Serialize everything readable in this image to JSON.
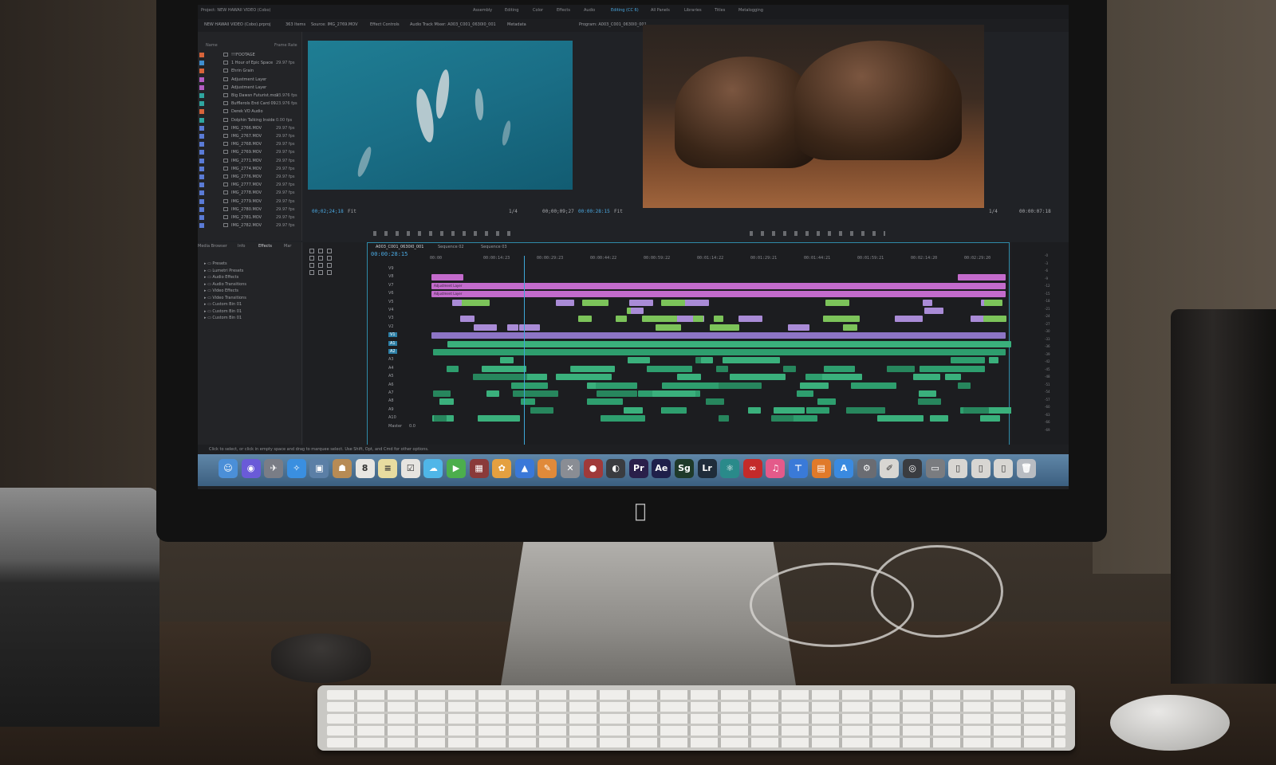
{
  "screen": {
    "project_title": "Project: NEW HAWAII VIDEO (Cobo)",
    "project_file": "NEW HAWAII VIDEO (Cobo).prproj",
    "items_count": "363 Items",
    "workspaces": [
      "Assembly",
      "Editing",
      "Color",
      "Effects",
      "Audio",
      "Editing (CC 6)",
      "All Panels",
      "Libraries",
      "Titles",
      "Metalogging"
    ],
    "active_workspace": "Editing (CC 6)",
    "source_tab": "Source: IMG_2769.MOV",
    "effect_controls_tab": "Effect Controls",
    "audio_mixer_tab": "Audio Track Mixer: A003_C001_0630I0_001",
    "metadata_tab": "Metadata",
    "program_tab": "Program: A003_C001_0630I0_001",
    "project_columns": {
      "name": "Name",
      "frame_rate": "Frame Rate"
    },
    "project_items": [
      {
        "name": "!!!FOOTAGE",
        "rate": "",
        "color": "#d8643a"
      },
      {
        "name": "1 Hour of Epic Space",
        "rate": "29.97 fps",
        "color": "#3f8fd0"
      },
      {
        "name": "Ehrin Grain",
        "rate": "",
        "color": "#d8643a"
      },
      {
        "name": "Adjustment Layer",
        "rate": "",
        "color": "#b45cc4"
      },
      {
        "name": "Adjustment Layer",
        "rate": "",
        "color": "#b45cc4"
      },
      {
        "name": "Big Dawsn Futurist.mov",
        "rate": "23.976 fps",
        "color": "#2fa6a0"
      },
      {
        "name": "Bufflerols End Card 09",
        "rate": "23.976 fps",
        "color": "#2fa6a0"
      },
      {
        "name": "Derek VO Audio",
        "rate": "",
        "color": "#d8643a"
      },
      {
        "name": "Dolphin Talking Inside",
        "rate": "0.00 fps",
        "color": "#2fa6a0"
      },
      {
        "name": "IMG_2766.MOV",
        "rate": "29.97 fps",
        "color": "#5a7bd6"
      },
      {
        "name": "IMG_2767.MOV",
        "rate": "29.97 fps",
        "color": "#5a7bd6"
      },
      {
        "name": "IMG_2768.MOV",
        "rate": "29.97 fps",
        "color": "#5a7bd6"
      },
      {
        "name": "IMG_2769.MOV",
        "rate": "29.97 fps",
        "color": "#5a7bd6"
      },
      {
        "name": "IMG_2771.MOV",
        "rate": "29.97 fps",
        "color": "#5a7bd6"
      },
      {
        "name": "IMG_2774.MOV",
        "rate": "29.97 fps",
        "color": "#5a7bd6"
      },
      {
        "name": "IMG_2776.MOV",
        "rate": "29.97 fps",
        "color": "#5a7bd6"
      },
      {
        "name": "IMG_2777.MOV",
        "rate": "29.97 fps",
        "color": "#5a7bd6"
      },
      {
        "name": "IMG_2778.MOV",
        "rate": "29.97 fps",
        "color": "#5a7bd6"
      },
      {
        "name": "IMG_2779.MOV",
        "rate": "29.97 fps",
        "color": "#5a7bd6"
      },
      {
        "name": "IMG_2780.MOV",
        "rate": "29.97 fps",
        "color": "#5a7bd6"
      },
      {
        "name": "IMG_2781.MOV",
        "rate": "29.97 fps",
        "color": "#5a7bd6"
      },
      {
        "name": "IMG_2782.MOV",
        "rate": "29.97 fps",
        "color": "#5a7bd6"
      }
    ],
    "source_timecode": "00;02;24;18",
    "source_fit": "Fit",
    "source_scale": "1/4",
    "source_duration": "00;00;09;27",
    "program_timecode": "00:00:28:15",
    "program_fit": "Fit",
    "program_scale": "1/4",
    "program_duration": "00:00:07:18",
    "effects_tabs": [
      "Media Browser",
      "Info",
      "Effects",
      "Mar"
    ],
    "effects_active": "Effects",
    "effects_items": [
      "Presets",
      "Lumetri Presets",
      "Audio Effects",
      "Audio Transitions",
      "Video Effects",
      "Video Transitions",
      "Custom Bin 01",
      "Custom Bin 01",
      "Custom Bin 01"
    ],
    "sequence_tabs": [
      "A003_C001_0630I0_001",
      "Sequence 02",
      "Sequence 03"
    ],
    "sequence_active": "A003_C001_0630I0_001",
    "timeline_timecode": "00:00:28:15",
    "ruler_labels": [
      "00:00",
      "00:00:14:23",
      "00:00:29:23",
      "00:00:44:22",
      "00:00:59:22",
      "00:01:14:22",
      "00:01:29:21",
      "00:01:44:21",
      "00:01:59:21",
      "00:02:14:20",
      "00:02:29:20"
    ],
    "video_tracks": [
      "V9",
      "V8",
      "V7",
      "V6",
      "V5",
      "V4",
      "V3",
      "V2",
      "V1"
    ],
    "audio_tracks": [
      "A1",
      "A2",
      "A3",
      "A4",
      "A5",
      "A6",
      "A7",
      "A8",
      "A9",
      "A10"
    ],
    "master_label": "Master",
    "master_value": "0.0",
    "adjustment_label": "Adjustment Layer",
    "status_text": "Click to select, or click in empty space and drag to marquee select. Use Shift, Opt, and Cmd for other options.",
    "dock_apps": [
      {
        "name": "finder-icon",
        "glyph": "☺",
        "color": "#4b8fd8"
      },
      {
        "name": "siri-icon",
        "glyph": "◉",
        "color": "#6a5bd8"
      },
      {
        "name": "launchpad-icon",
        "glyph": "✈",
        "color": "#7a7d86"
      },
      {
        "name": "safari-icon",
        "glyph": "✧",
        "color": "#3a8fe0"
      },
      {
        "name": "preview-icon",
        "glyph": "▣",
        "color": "#5b7fa6"
      },
      {
        "name": "contacts-icon",
        "glyph": "☗",
        "color": "#b78b55"
      },
      {
        "name": "calendar-icon",
        "glyph": "8",
        "color": "#e8e6e2"
      },
      {
        "name": "notes-icon",
        "glyph": "≡",
        "color": "#e8dca0"
      },
      {
        "name": "reminders-icon",
        "glyph": "☑",
        "color": "#e6e4e0"
      },
      {
        "name": "messages-icon",
        "glyph": "☁",
        "color": "#4fb6e8"
      },
      {
        "name": "facetime-icon",
        "glyph": "▶",
        "color": "#4cae4c"
      },
      {
        "name": "photobooth-icon",
        "glyph": "▦",
        "color": "#8a3a3a"
      },
      {
        "name": "photos-icon",
        "glyph": "✿",
        "color": "#e4a040"
      },
      {
        "name": "keynote-icon",
        "glyph": "▲",
        "color": "#3a78d8"
      },
      {
        "name": "pages-icon",
        "glyph": "✎",
        "color": "#e08a3a"
      },
      {
        "name": "xcode-icon",
        "glyph": "✕",
        "color": "#8a8d94"
      },
      {
        "name": "davinci-icon",
        "glyph": "●",
        "color": "#a03a3a"
      },
      {
        "name": "logic-icon",
        "glyph": "◐",
        "color": "#3a3c40"
      },
      {
        "name": "premiere-icon",
        "glyph": "Pr",
        "color": "#2a1f4a"
      },
      {
        "name": "after-effects-icon",
        "glyph": "Ae",
        "color": "#1f1f4a"
      },
      {
        "name": "speedgrade-icon",
        "glyph": "Sg",
        "color": "#1f3a2a"
      },
      {
        "name": "lightroom-icon",
        "glyph": "Lr",
        "color": "#1f2c3a"
      },
      {
        "name": "atom-icon",
        "glyph": "⚛",
        "color": "#2a8a8a"
      },
      {
        "name": "creative-cloud-icon",
        "glyph": "∞",
        "color": "#c42a2a"
      },
      {
        "name": "itunes-icon",
        "glyph": "♫",
        "color": "#e45a8a"
      },
      {
        "name": "keynote-remote-icon",
        "glyph": "⊤",
        "color": "#3a7ad8"
      },
      {
        "name": "ibooks-icon",
        "glyph": "▤",
        "color": "#e07a2a"
      },
      {
        "name": "app-store-icon",
        "glyph": "A",
        "color": "#3a8ae0"
      },
      {
        "name": "system-preferences-icon",
        "glyph": "⚙",
        "color": "#6a6c72"
      },
      {
        "name": "textedit-icon",
        "glyph": "✐",
        "color": "#d8d6d2"
      },
      {
        "name": "camera-icon",
        "glyph": "◎",
        "color": "#3a3c40"
      },
      {
        "name": "terminal-icon",
        "glyph": "▭",
        "color": "#7a7c80"
      },
      {
        "name": "document-icon",
        "glyph": "▯",
        "color": "#d8d6d2"
      },
      {
        "name": "document-2-icon",
        "glyph": "▯",
        "color": "#d8d6d2"
      },
      {
        "name": "document-3-icon",
        "glyph": "▯",
        "color": "#d8d6d2"
      },
      {
        "name": "trash-icon",
        "glyph": "🗑",
        "color": "#b8bcc2"
      }
    ]
  }
}
